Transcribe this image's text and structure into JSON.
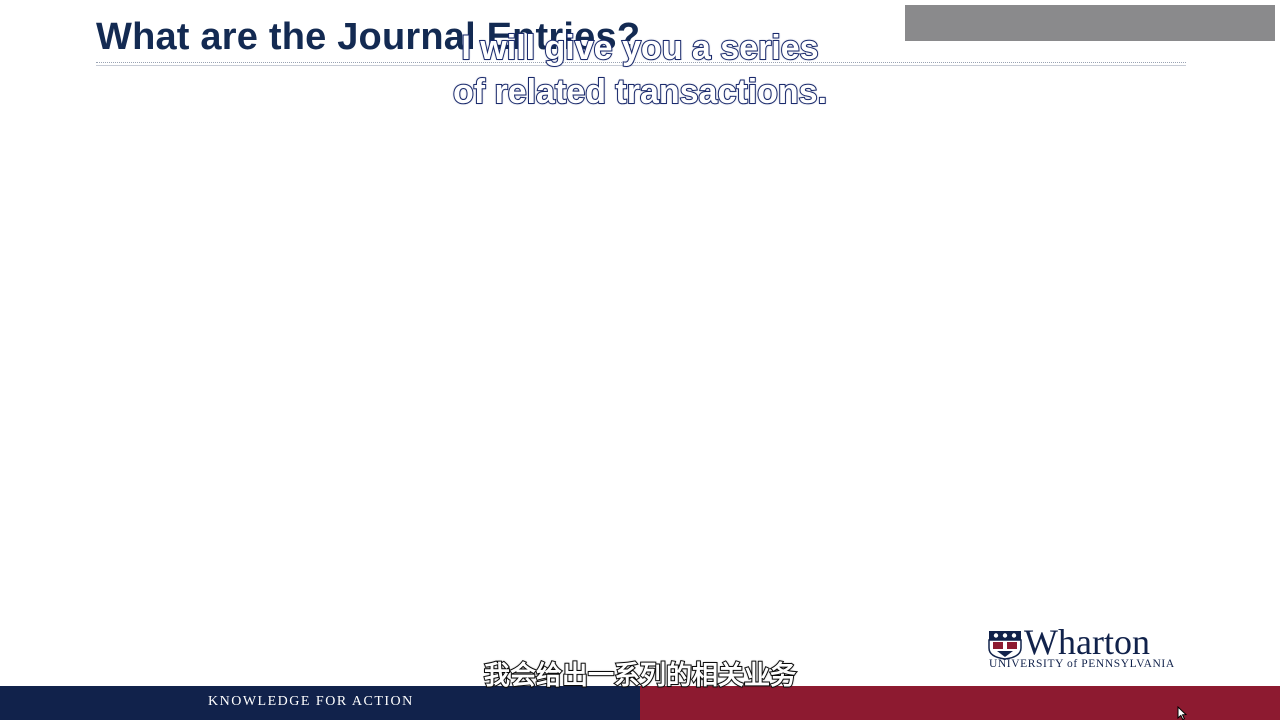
{
  "slide": {
    "title": "What are the Journal Entries?"
  },
  "subtitles": {
    "english_line1": "I will give you a series",
    "english_line2": "of related transactions.",
    "chinese": "我会给出一系列的相关业务"
  },
  "footer": {
    "tagline": "KNOWLEDGE FOR ACTION"
  },
  "logo": {
    "name": "Wharton",
    "subtitle": "UNIVERSITY of PENNSYLVANIA"
  },
  "colors": {
    "title": "#132a52",
    "footer_left": "#11224b",
    "footer_right": "#8d1a30",
    "gray_box": "#8a8a8c"
  }
}
